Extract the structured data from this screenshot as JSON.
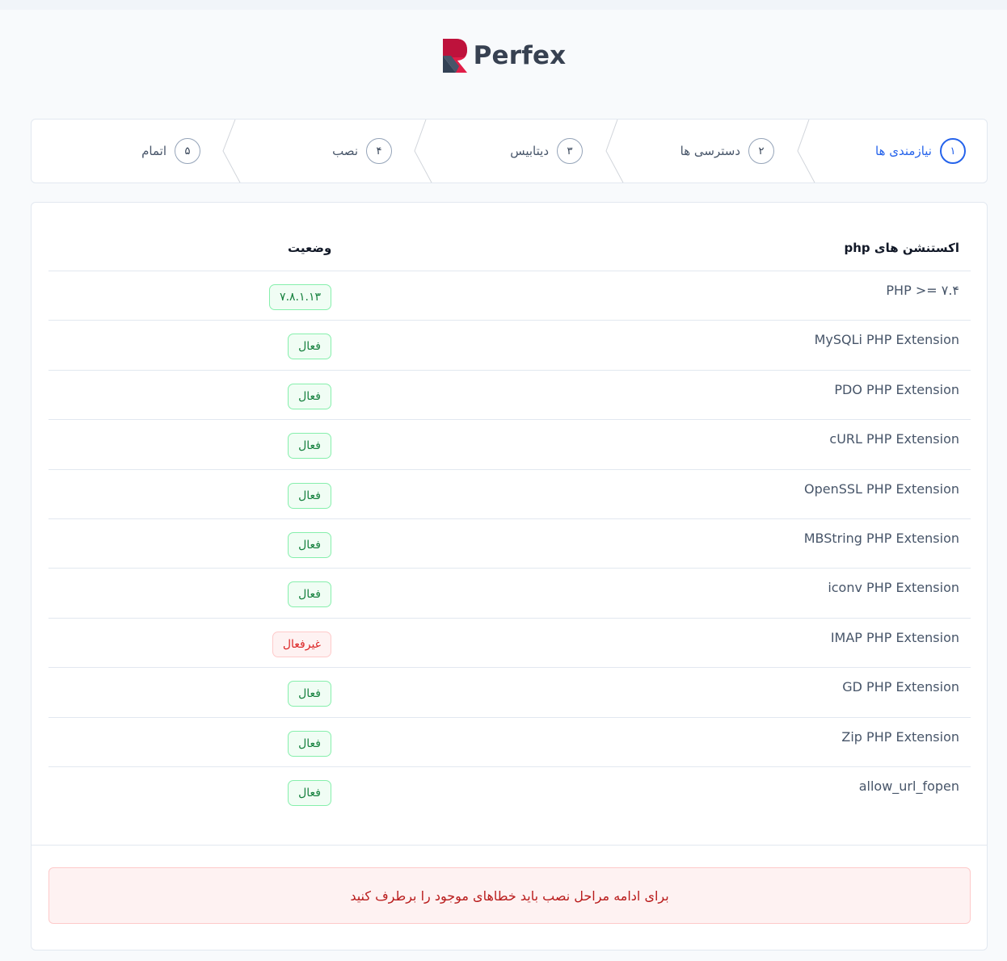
{
  "brand": {
    "name": "Perfex"
  },
  "steps": [
    {
      "num": "۱",
      "label": "نیازمندی ها"
    },
    {
      "num": "۲",
      "label": "دسترسی ها"
    },
    {
      "num": "۳",
      "label": "دیتابیس"
    },
    {
      "num": "۴",
      "label": "نصب"
    },
    {
      "num": "۵",
      "label": "اتمام"
    }
  ],
  "table": {
    "header_extension": "اکستنشن های php",
    "header_status": "وضعیت",
    "rows": [
      {
        "name": "PHP >= ۷.۴",
        "status": "۷.۸.۱.۱۳",
        "ok": true
      },
      {
        "name": "MySQLi PHP Extension",
        "status": "فعال",
        "ok": true
      },
      {
        "name": "PDO PHP Extension",
        "status": "فعال",
        "ok": true
      },
      {
        "name": "cURL PHP Extension",
        "status": "فعال",
        "ok": true
      },
      {
        "name": "OpenSSL PHP Extension",
        "status": "فعال",
        "ok": true
      },
      {
        "name": "MBString PHP Extension",
        "status": "فعال",
        "ok": true
      },
      {
        "name": "iconv PHP Extension",
        "status": "فعال",
        "ok": true
      },
      {
        "name": "IMAP PHP Extension",
        "status": "غیرفعال",
        "ok": false
      },
      {
        "name": "GD PHP Extension",
        "status": "فعال",
        "ok": true
      },
      {
        "name": "Zip PHP Extension",
        "status": "فعال",
        "ok": true
      },
      {
        "name": "allow_url_fopen",
        "status": "فعال",
        "ok": true
      }
    ]
  },
  "alert": {
    "message": "برای ادامه مراحل نصب باید خطاهای موجود را برطرف کنید"
  },
  "colors": {
    "accent": "#2563eb",
    "success": "#15803d",
    "danger": "#dc2626"
  }
}
